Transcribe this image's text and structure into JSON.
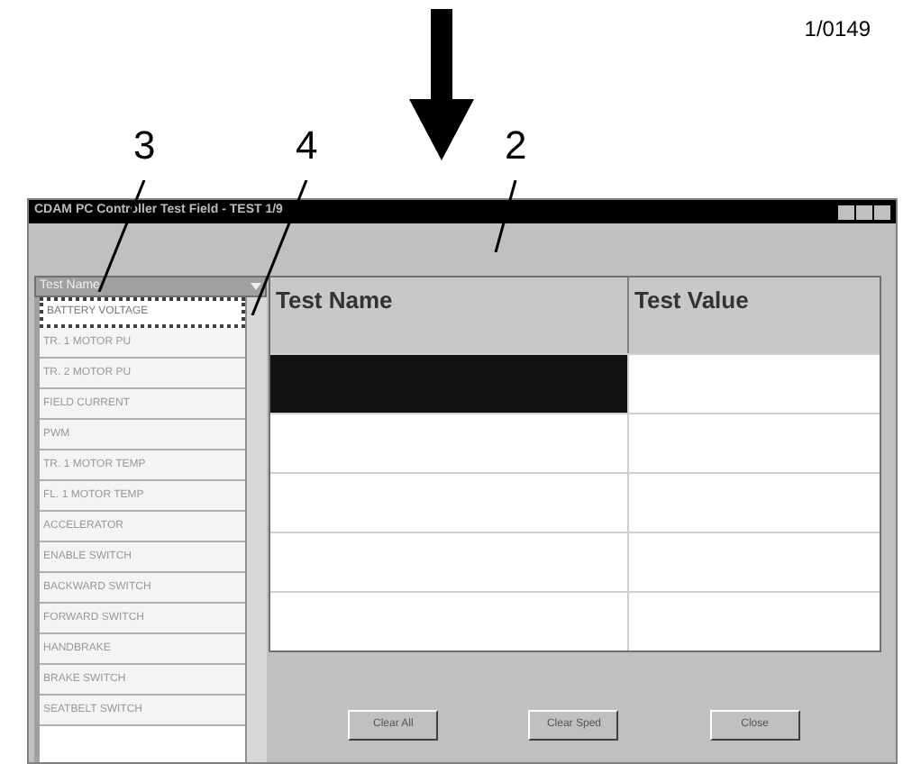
{
  "figure_number": "1/0149",
  "callouts": [
    {
      "label": "3"
    },
    {
      "label": "4"
    },
    {
      "label": "2"
    }
  ],
  "window": {
    "title": "CDAM PC Controller Test Field - TEST 1/9"
  },
  "dropdown": {
    "value": "Test Name"
  },
  "list_items": [
    {
      "label": "BATTERY VOLTAGE",
      "selected": true
    },
    {
      "label": "TR. 1 MOTOR PU",
      "selected": false
    },
    {
      "label": "TR. 2 MOTOR PU",
      "selected": false
    },
    {
      "label": "FIELD CURRENT",
      "selected": false
    },
    {
      "label": "PWM",
      "selected": false
    },
    {
      "label": "TR. 1 MOTOR TEMP",
      "selected": false
    },
    {
      "label": "FL. 1 MOTOR TEMP",
      "selected": false
    },
    {
      "label": "ACCELERATOR",
      "selected": false
    },
    {
      "label": "ENABLE SWITCH",
      "selected": false
    },
    {
      "label": "BACKWARD SWITCH",
      "selected": false
    },
    {
      "label": "FORWARD SWITCH",
      "selected": false
    },
    {
      "label": "HANDBRAKE",
      "selected": false
    },
    {
      "label": "BRAKE SWITCH",
      "selected": false
    },
    {
      "label": "SEATBELT SWITCH",
      "selected": false
    }
  ],
  "table": {
    "columns": [
      "Test Name",
      "Test Value"
    ],
    "rows": [
      {
        "selected": true
      },
      {
        "selected": false
      },
      {
        "selected": false
      },
      {
        "selected": false
      },
      {
        "selected": false
      }
    ]
  },
  "buttons": [
    "Clear All",
    "Clear Sped",
    "Close"
  ]
}
